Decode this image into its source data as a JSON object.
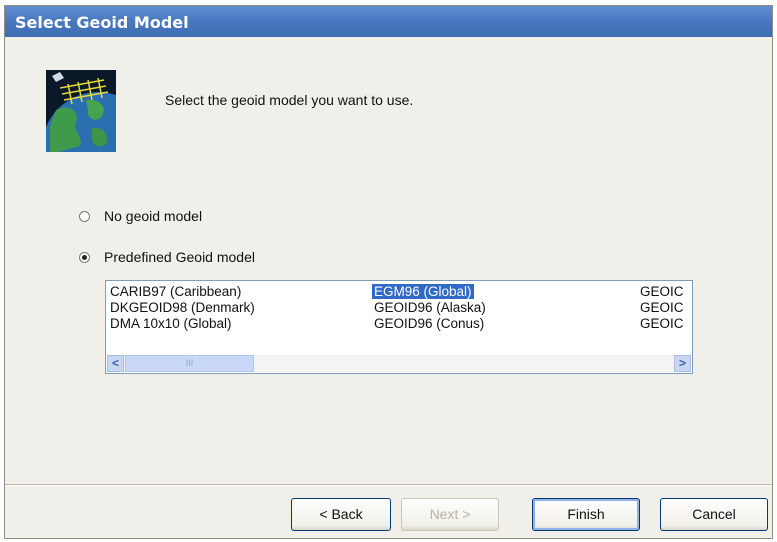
{
  "window": {
    "title": "Select Geoid Model"
  },
  "header": {
    "prompt": "Select the geoid model you want to use."
  },
  "options": {
    "none_label": "No geoid model",
    "predefined_label": "Predefined Geoid model",
    "selected": "predefined"
  },
  "geoid_list": {
    "columns": [
      [
        "CARIB97 (Caribbean)",
        "DKGEOID98 (Denmark)",
        "DMA 10x10 (Global)"
      ],
      [
        "EGM96 (Global)",
        "GEOID96 (Alaska)",
        "GEOID96 (Conus)"
      ],
      [
        "GEOIC",
        "GEOIC",
        "GEOIC"
      ]
    ],
    "selected_item": "EGM96 (Global)",
    "scroll_left": "<",
    "scroll_right": ">",
    "thumb_grip": "III"
  },
  "buttons": {
    "back": "< Back",
    "next": "Next >",
    "finish": "Finish",
    "cancel": "Cancel"
  },
  "colors": {
    "titlebar": "#4878bf",
    "selection": "#3169c6",
    "dialog_bg": "#f0efe9"
  }
}
